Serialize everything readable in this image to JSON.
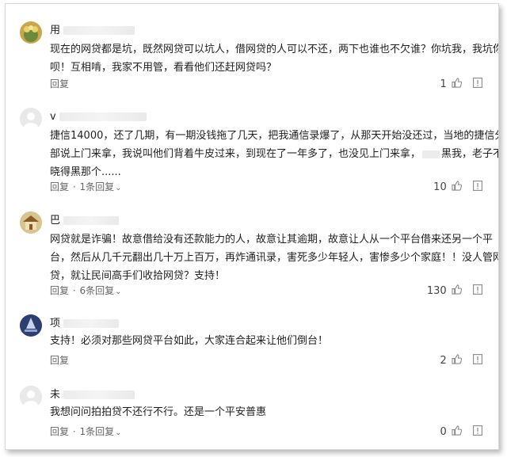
{
  "ui": {
    "reply_label": "回复",
    "dot": "·",
    "chevron": "⌄"
  },
  "comments": [
    {
      "username": "用",
      "lines": [
        "现在的网贷都是坑，既然网贷可以坑人，借网贷的人可以不还，两下也谁也不欠谁？你坑我，我坑你",
        "呗！互相啃，我家不用管，看看他们还赶网贷吗？"
      ],
      "replies": "",
      "likes": "1"
    },
    {
      "username": "v",
      "lines": [
        "捷信14000，还了几期，有一期没钱拖了几天，把我通信录爆了，从那天开始没还过，当地的捷信分",
        "部说上门来拿，我说叫他们背着牛皮过来，到现在了一年多了，也没见上门来拿，",
        "晓得黑那个......"
      ],
      "line2_tail": "黑我，老子不",
      "replies": "1条回复",
      "likes": "10"
    },
    {
      "username": "巴",
      "lines": [
        "网贷就是诈骗！故意借给没有还款能力的人，故意让其逾期，故意让人从一个平台借来还另一个平",
        "台，然后从几千元翻出几十万上百万，再炸通讯录，害死多少年轻人，害惨多少个家庭！！没人管网",
        "贷，就让民间高手们收拾网贷？支持！"
      ],
      "replies": "6条回复",
      "likes": "130"
    },
    {
      "username": "项",
      "lines": [
        "支持！必须对那些网贷平台如此，大家连合起来让他们倒台！"
      ],
      "replies": "",
      "likes": "2"
    },
    {
      "username": "未",
      "lines": [
        "我想问问拍拍贷不还行不行。还是一个平安普惠"
      ],
      "replies": "1条回复",
      "likes": "0"
    }
  ]
}
